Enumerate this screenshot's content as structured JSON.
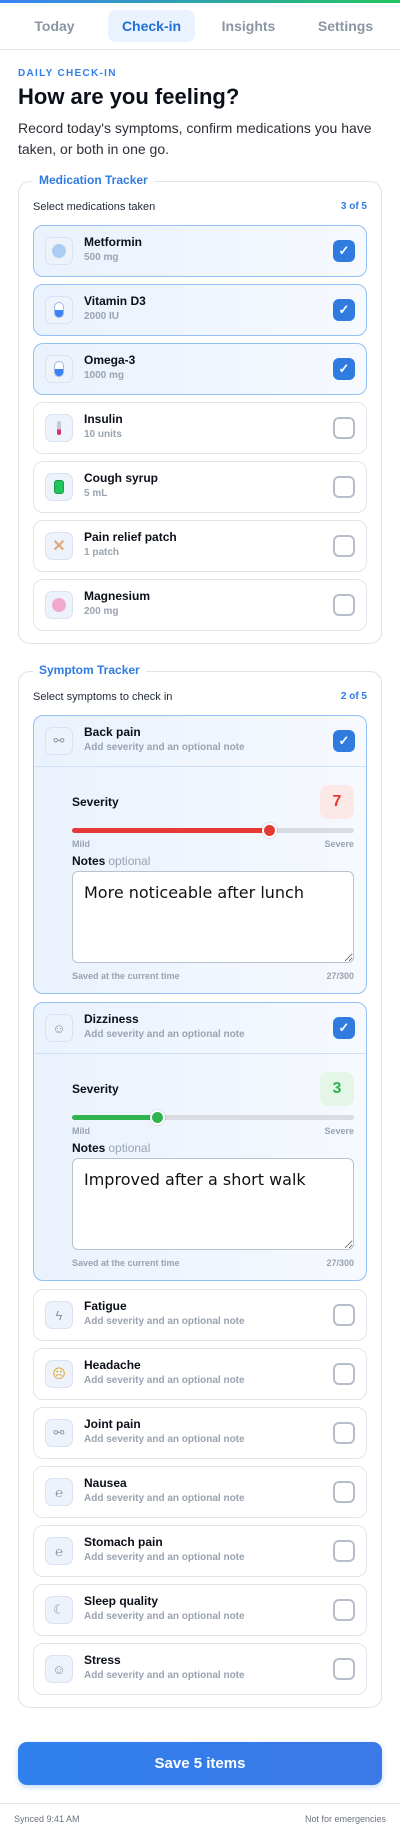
{
  "tabs": [
    {
      "label": "Today"
    },
    {
      "label": "Check-in"
    },
    {
      "label": "Insights"
    },
    {
      "label": "Settings"
    }
  ],
  "header": {
    "eyebrow": "DAILY CHECK-IN",
    "title": "How are you feeling?",
    "lead": "Record today's symptoms, confirm medications you have taken, or both in one go."
  },
  "medication": {
    "legend": "Medication Tracker",
    "subtitle": "Select medications taken",
    "count": "3 of 5",
    "items": [
      {
        "name": "Metformin",
        "dose": "500 mg",
        "icon": "tablet-icon",
        "checked": true
      },
      {
        "name": "Vitamin D3",
        "dose": "2000 IU",
        "icon": "capsule-icon",
        "checked": true
      },
      {
        "name": "Omega-3",
        "dose": "1000 mg",
        "icon": "capsule-icon",
        "checked": true
      },
      {
        "name": "Insulin",
        "dose": "10 units",
        "icon": "syringe-icon",
        "checked": false
      },
      {
        "name": "Cough syrup",
        "dose": "5 mL",
        "icon": "bottle-icon",
        "checked": false
      },
      {
        "name": "Pain relief patch",
        "dose": "1 patch",
        "icon": "bandage-icon",
        "checked": false
      },
      {
        "name": "Magnesium",
        "dose": "200 mg",
        "icon": "tablet-icon",
        "checked": false
      }
    ]
  },
  "symptoms": {
    "legend": "Symptom Tracker",
    "subtitle": "Select symptoms to check in",
    "count": "2 of 5",
    "hint": "Add severity and an optional note",
    "severity_label": "Severity",
    "range_min": "Mild",
    "range_max": "Severe",
    "notes_label": "Notes",
    "notes_optional": "optional",
    "saved_text": "Saved at the current time",
    "expanded": [
      {
        "name": "Back pain",
        "icon": "joint-icon",
        "severity": 7,
        "severity_max": 10,
        "color": "#e53935",
        "badge_bg": "#fde8e8",
        "note": "More noticeable after lunch",
        "char_count": "27/300"
      },
      {
        "name": "Dizziness",
        "icon": "head-icon",
        "severity": 3,
        "severity_max": 10,
        "color": "#2fb44f",
        "badge_bg": "#e3f6e8",
        "note": "Improved after a short walk",
        "char_count": "27/300"
      }
    ],
    "collapsed": [
      {
        "name": "Fatigue",
        "icon": "bolt-icon"
      },
      {
        "name": "Headache",
        "icon": "face-emoji-icon"
      },
      {
        "name": "Joint pain",
        "icon": "joint-icon"
      },
      {
        "name": "Nausea",
        "icon": "stomach-icon"
      },
      {
        "name": "Stomach pain",
        "icon": "stomach-icon"
      },
      {
        "name": "Sleep quality",
        "icon": "moon-icon"
      },
      {
        "name": "Stress",
        "icon": "smile-icon"
      }
    ]
  },
  "save_button": "Save 5 items",
  "status": {
    "left": "Synced 9:41 AM",
    "right": "Not for emergencies"
  }
}
